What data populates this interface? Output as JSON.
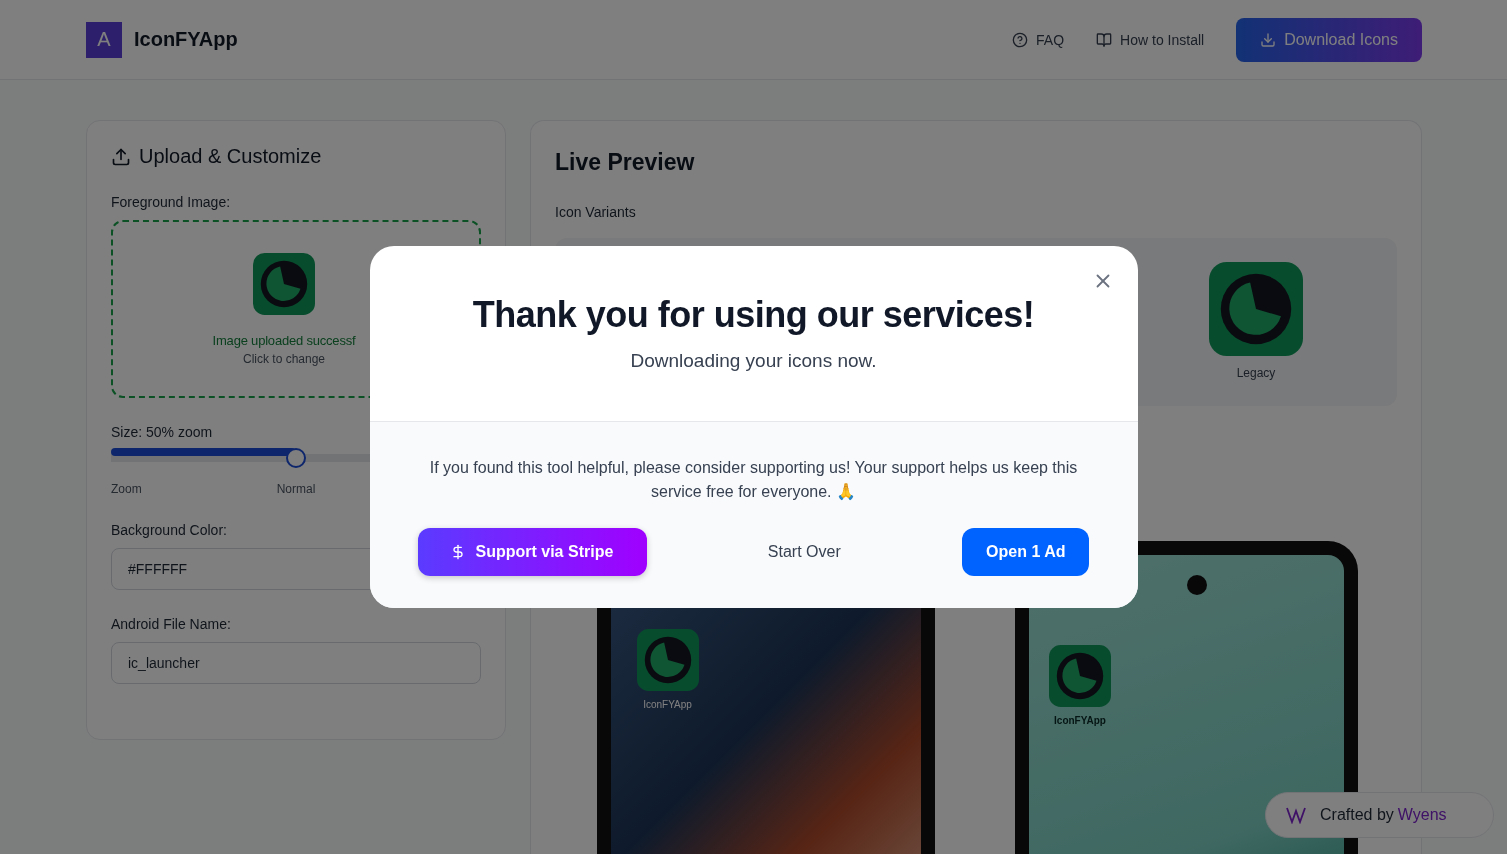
{
  "header": {
    "logo_letter": "A",
    "app_name": "IconFYApp",
    "nav": [
      {
        "kind": "faq",
        "label": "FAQ"
      },
      {
        "kind": "install",
        "label": "How to Install"
      }
    ],
    "download_button": "Download Icons"
  },
  "upload_panel": {
    "title": "Upload & Customize",
    "foreground_label": "Foreground Image:",
    "upload_status": "Image uploaded successf",
    "upload_hint": "Click to change",
    "size_label": "Size: 50% zoom",
    "slider": {
      "level": 0.5,
      "labels": [
        "Zoom",
        "Normal"
      ]
    },
    "background_label": "Background Color:",
    "background_value": "#FFFFFF",
    "file_name_label": "Android File Name:",
    "file_name_value": "ic_launcher"
  },
  "preview_panel": {
    "title": "Live Preview",
    "variants_label": "Icon Variants",
    "variants": [
      {
        "label": "Legacy"
      }
    ],
    "devices": [
      {
        "kind": "iphone",
        "app_label": "IconFYApp"
      },
      {
        "kind": "android",
        "app_label": "IconFYApp"
      }
    ]
  },
  "credit": {
    "text": "Crafted by",
    "brand": "Wyens"
  },
  "modal": {
    "title": "Thank you for using our services!",
    "subtitle": "Downloading your icons now.",
    "message": "If you found this tool helpful, please consider supporting us! Your support helps us keep this service free for everyone. 🙏",
    "buttons": [
      {
        "kind": "stripe",
        "label": "Support via Stripe"
      },
      {
        "kind": "plain",
        "label": "Start Over"
      },
      {
        "kind": "ad",
        "label": "Open 1 Ad"
      }
    ]
  }
}
